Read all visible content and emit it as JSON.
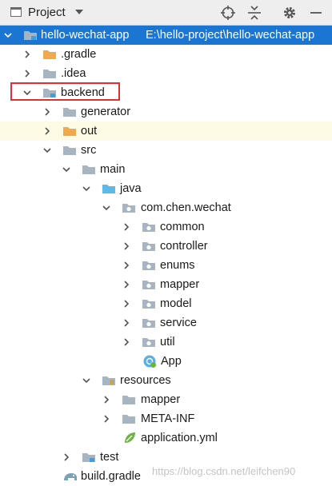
{
  "header": {
    "title": "Project",
    "icons": [
      "project-view-icon",
      "dropdown-arrow-icon",
      "locate-icon",
      "collapse-all-icon",
      "settings-gear-icon",
      "hide-panel-icon"
    ]
  },
  "tree": [
    {
      "label": "hello-wechat-app",
      "path": "E:\\hello-project\\hello-wechat-app",
      "level": 0,
      "expanded": true,
      "icon": "module-folder-icon",
      "selected": true
    },
    {
      "label": ".gradle",
      "level": 1,
      "expanded": false,
      "icon": "orange-folder-icon"
    },
    {
      "label": ".idea",
      "level": 1,
      "expanded": false,
      "icon": "folder-icon"
    },
    {
      "label": "backend",
      "level": 1,
      "expanded": true,
      "icon": "module-folder-icon",
      "annotated": true
    },
    {
      "label": "generator",
      "level": 2,
      "expanded": false,
      "icon": "folder-icon"
    },
    {
      "label": "out",
      "level": 2,
      "expanded": false,
      "icon": "orange-folder-icon",
      "highlighted": true
    },
    {
      "label": "src",
      "level": 2,
      "expanded": true,
      "icon": "folder-icon"
    },
    {
      "label": "main",
      "level": 3,
      "expanded": true,
      "icon": "folder-icon"
    },
    {
      "label": "java",
      "level": 4,
      "expanded": true,
      "icon": "source-folder-icon"
    },
    {
      "label": "com.chen.wechat",
      "level": 5,
      "expanded": true,
      "icon": "package-icon"
    },
    {
      "label": "common",
      "level": 6,
      "expanded": false,
      "icon": "package-icon"
    },
    {
      "label": "controller",
      "level": 6,
      "expanded": false,
      "icon": "package-icon"
    },
    {
      "label": "enums",
      "level": 6,
      "expanded": false,
      "icon": "package-icon"
    },
    {
      "label": "mapper",
      "level": 6,
      "expanded": false,
      "icon": "package-icon"
    },
    {
      "label": "model",
      "level": 6,
      "expanded": false,
      "icon": "package-icon"
    },
    {
      "label": "service",
      "level": 6,
      "expanded": false,
      "icon": "package-icon"
    },
    {
      "label": "util",
      "level": 6,
      "expanded": false,
      "icon": "package-icon"
    },
    {
      "label": "App",
      "level": 6,
      "icon": "spring-class-icon"
    },
    {
      "label": "resources",
      "level": 4,
      "expanded": true,
      "icon": "resources-folder-icon"
    },
    {
      "label": "mapper",
      "level": 5,
      "expanded": false,
      "icon": "folder-icon"
    },
    {
      "label": "META-INF",
      "level": 5,
      "expanded": false,
      "icon": "folder-icon"
    },
    {
      "label": "application.yml",
      "level": 5,
      "icon": "spring-yml-icon"
    },
    {
      "label": "test",
      "level": 3,
      "expanded": false,
      "icon": "test-folder-icon"
    },
    {
      "label": "build.gradle",
      "level": 2,
      "icon": "gradle-icon"
    }
  ],
  "watermark": "https://blog.csdn.net/leifchen90",
  "colors": {
    "selection": "#1a76d2",
    "highlight_row": "#fdfbe3",
    "annotation_box": "#e03030"
  }
}
